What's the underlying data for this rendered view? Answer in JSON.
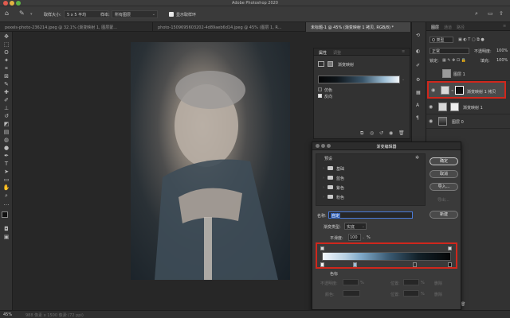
{
  "window": {
    "title": "Adobe Photoshop 2020"
  },
  "options_bar": {
    "sample_size_label": "取样大小:",
    "sample_size_value": "5 x 5 平均",
    "sample_label": "样本:",
    "sample_value": "所有图层",
    "show_ring_label": "显示取样环",
    "show_ring_checked": true
  },
  "tabs": [
    {
      "label": "pexels-photo-236214.jpeg @ 32.1% (渐变映射 1, 图层蒙...",
      "active": false
    },
    {
      "label": "photo-1509695603202-4d89aeb6d14.jpeg @ 45% (图层 1, R...",
      "active": false
    },
    {
      "label": "未标题-1 @ 45% (渐变映射 1 拷贝, RGB/8) *",
      "active": true
    }
  ],
  "properties_panel": {
    "tab1": "属性",
    "tab2": "调整",
    "title": "渐变映射",
    "dither_label": "仿色",
    "reverse_label": "反向",
    "reverse_checked": true
  },
  "layers_panel": {
    "tabs": [
      "图层",
      "通道",
      "路径"
    ],
    "filter_label": "Q 类型",
    "blend_mode": "正常",
    "opacity_label": "不透明度:",
    "opacity_value": "100%",
    "lock_label": "锁定:",
    "fill_label": "填充:",
    "fill_value": "100%",
    "layers": [
      {
        "name": "图层 1",
        "highlighted": false
      },
      {
        "name": "渐变映射 1 拷贝",
        "highlighted": true
      },
      {
        "name": "渐变映射 1",
        "highlighted": false
      },
      {
        "name": "图层 0",
        "highlighted": false
      }
    ]
  },
  "gradient_editor": {
    "title": "渐变编辑器",
    "presets_label": "预设",
    "folders": [
      "基础",
      "蓝色",
      "紫色",
      "粉色"
    ],
    "name_label": "名称:",
    "name_value": "自定",
    "type_label": "渐变类型:",
    "type_value": "实底",
    "smoothness_label": "平滑度:",
    "smoothness_value": "100",
    "smoothness_unit": "%",
    "stops_section_label": "色标",
    "opacity_label": "不透明度:",
    "opacity_unit": "%",
    "location_label": "位置:",
    "location_unit": "%",
    "delete_label": "删除",
    "color_label": "颜色:",
    "buttons": {
      "ok": "确定",
      "cancel": "取消",
      "import": "导入...",
      "export": "导出...",
      "new": "新建"
    }
  },
  "status_bar": {
    "zoom": "45%",
    "doc_info": "988 像素 x 1500 像素 (72 ppi)"
  },
  "colors": {
    "highlight_red": "#d0271c",
    "gradient_start": "#f2f6fb",
    "gradient_mid": "#7fa8c8",
    "gradient_end": "#050607"
  },
  "icons": [
    "home-icon",
    "eyedropper-icon",
    "search-icon",
    "eye-icon",
    "folder-icon",
    "gear-icon"
  ]
}
